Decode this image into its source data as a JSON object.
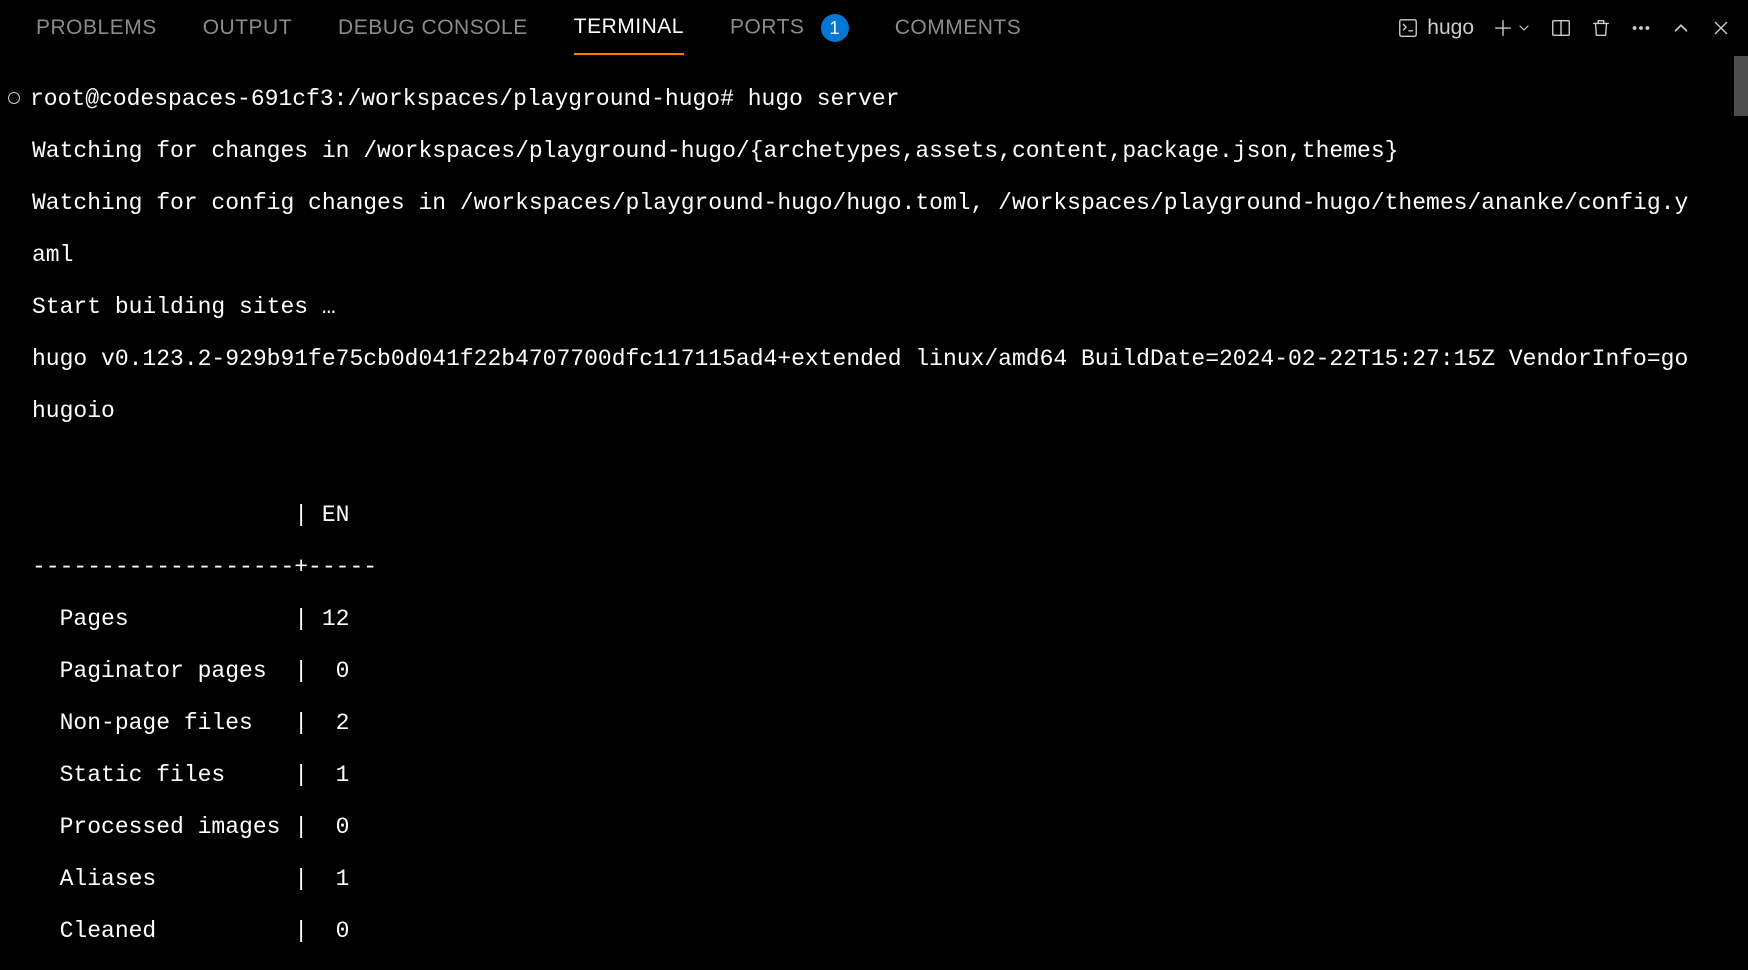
{
  "tabs": {
    "problems": "PROBLEMS",
    "output": "OUTPUT",
    "debug_console": "DEBUG CONSOLE",
    "terminal": "TERMINAL",
    "ports": "PORTS",
    "ports_count": "1",
    "comments": "COMMENTS"
  },
  "shell": {
    "name": "hugo"
  },
  "terminal": {
    "prompt": "root@codespaces-691cf3:/workspaces/playground-hugo# hugo server",
    "line1": "Watching for changes in /workspaces/playground-hugo/{archetypes,assets,content,package.json,themes}",
    "line2": "Watching for config changes in /workspaces/playground-hugo/hugo.toml, /workspaces/playground-hugo/themes/ananke/config.y",
    "line3": "aml",
    "line4": "Start building sites …",
    "line5": "hugo v0.123.2-929b91fe75cb0d041f22b4707700dfc117115ad4+extended linux/amd64 BuildDate=2024-02-22T15:27:15Z VendorInfo=go",
    "line6": "hugoio",
    "blank": "",
    "table_header": "                   | EN  ",
    "table_sep": "-------------------+-----",
    "row_pages": "  Pages            | 12  ",
    "row_paginator": "  Paginator pages  |  0  ",
    "row_nonpage": "  Non-page files   |  2  ",
    "row_static": "  Static files     |  1  ",
    "row_processed": "  Processed images |  0  ",
    "row_aliases": "  Aliases          |  1  ",
    "row_cleaned": "  Cleaned          |  0  "
  }
}
